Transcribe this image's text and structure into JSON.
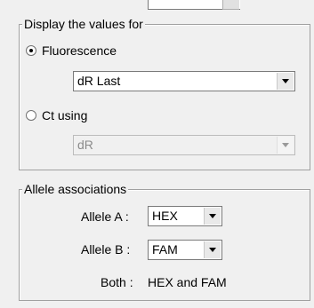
{
  "display_group": {
    "legend": "Display the values for",
    "fluorescence_label": "Fluorescence",
    "fluorescence_selected": true,
    "fluorescence_value": "dR Last",
    "ct_label": "Ct using",
    "ct_selected": false,
    "ct_value": "dR"
  },
  "allele_group": {
    "legend": "Allele associations",
    "allele_a_label": "Allele A :",
    "allele_a_value": "HEX",
    "allele_b_label": "Allele B :",
    "allele_b_value": "FAM",
    "both_label": "Both :",
    "both_value": "HEX and FAM"
  }
}
